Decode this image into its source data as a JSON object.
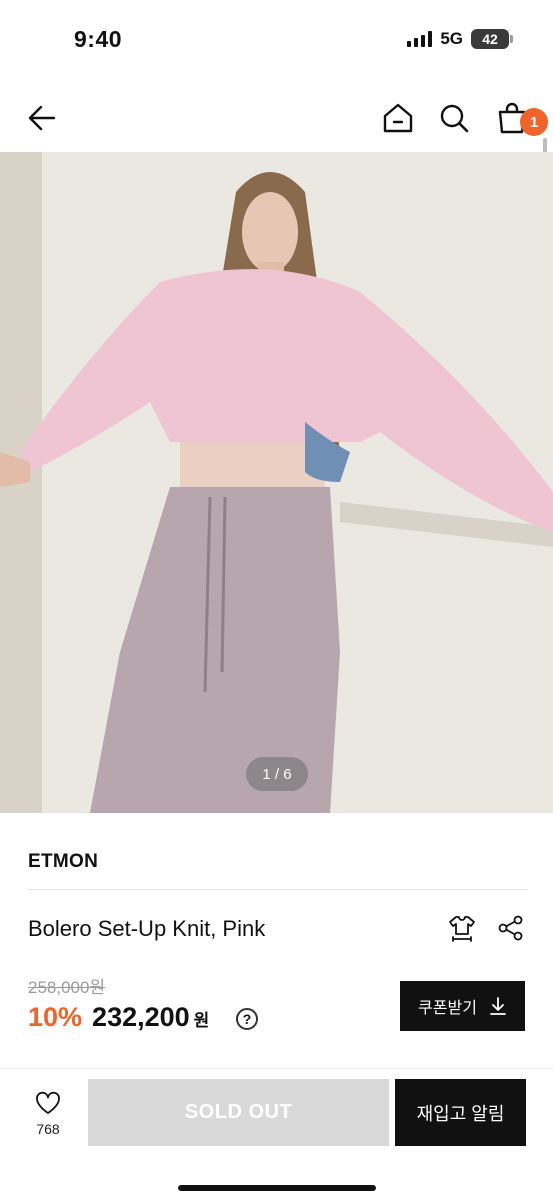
{
  "status_bar": {
    "time": "9:40",
    "network": "5G",
    "battery": "42"
  },
  "nav": {
    "cart_count": "1"
  },
  "gallery": {
    "counter": "1 / 6"
  },
  "product": {
    "brand": "ETMON",
    "name": "Bolero Set-Up Knit, Pink",
    "original_price": "258,000원",
    "discount": "10%",
    "sale_price": "232,200",
    "currency": "원",
    "help": "?"
  },
  "coupon": {
    "label": "쿠폰받기"
  },
  "bottom_bar": {
    "like_count": "768",
    "sold_out_label": "SOLD OUT",
    "restock_label": "재입고 알림"
  },
  "colors": {
    "accent": "#f0632a",
    "dark": "#111111",
    "disabled": "#d9d9d9"
  }
}
